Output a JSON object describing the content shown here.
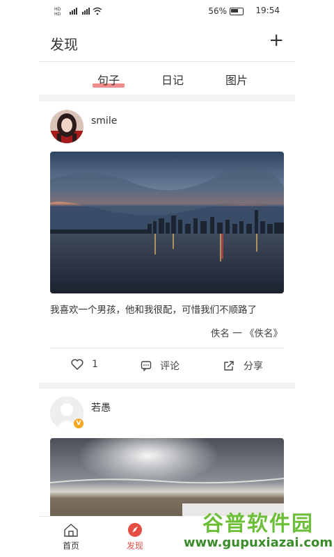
{
  "status_bar": {
    "left_icons": "HD ⁴⁶ ⁴⁶ wifi",
    "battery_pct": "56%",
    "time": "19:54"
  },
  "header": {
    "title": "发现",
    "add_icon": "plus-icon"
  },
  "tabs": [
    {
      "label": "句子",
      "active": true
    },
    {
      "label": "日记",
      "active": false
    },
    {
      "label": "图片",
      "active": false
    }
  ],
  "posts": [
    {
      "username": "smile",
      "text": "我喜欢一个男孩，他和我很配，可惜我们不顺路了",
      "attribution": "佚名 一 《佚名》",
      "like_count": "1",
      "comment_label": "评论",
      "share_label": "分享"
    },
    {
      "username": "若愚",
      "verified_badge": "V"
    }
  ],
  "bottom_nav": [
    {
      "label": "首页",
      "icon": "home-icon",
      "active": false
    },
    {
      "label": "发现",
      "icon": "compass-icon",
      "active": true
    }
  ],
  "watermark": {
    "top": "谷普软件园",
    "bottom": "www.gupuxiazai.com"
  },
  "colors": {
    "accent": "#e54d42",
    "tab_underline": "#f08c8c",
    "divider": "#f3f3f3"
  }
}
